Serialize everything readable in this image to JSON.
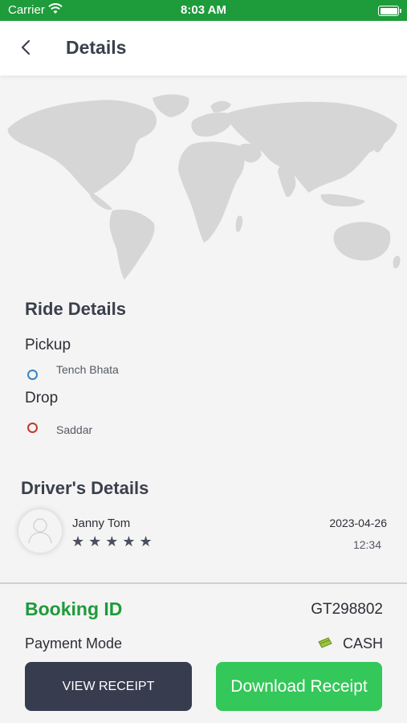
{
  "status_bar": {
    "carrier": "Carrier",
    "time": "8:03 AM"
  },
  "nav": {
    "back_icon": "chevron-left-icon",
    "title": "Details"
  },
  "ride": {
    "section_title": "Ride Details",
    "pickup_label": "Pickup",
    "pickup_location": "Tench Bhata",
    "pickup_color": "#3b82c4",
    "drop_label": "Drop",
    "drop_location": "Saddar",
    "drop_color": "#c0392b"
  },
  "driver": {
    "section_title": "Driver's Details",
    "name": "Janny Tom",
    "rating": 5,
    "stars": "★★★★★",
    "date": "2023-04-26",
    "time": "12:34"
  },
  "booking": {
    "label": "Booking ID",
    "value": "GT298802"
  },
  "payment": {
    "label": "Payment Mode",
    "value": "CASH",
    "icon": "cash-icon"
  },
  "actions": {
    "view_receipt": "VIEW RECEIPT",
    "download_receipt": "Download Receipt"
  },
  "colors": {
    "brand_green": "#1e9b3a",
    "button_green": "#34c759",
    "button_dark": "#373d4e"
  }
}
